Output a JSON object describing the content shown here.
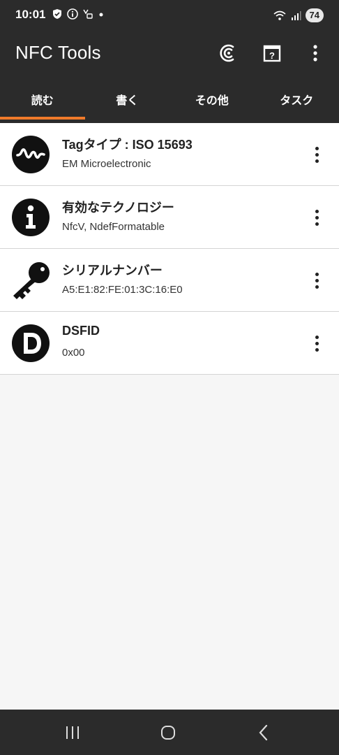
{
  "status": {
    "time": "10:01",
    "battery": "74"
  },
  "app": {
    "title": "NFC Tools",
    "actions": [
      "nfc-scan-icon",
      "help-icon",
      "more-icon"
    ]
  },
  "tabs": [
    {
      "label": "読む",
      "active": true
    },
    {
      "label": "書く",
      "active": false
    },
    {
      "label": "その他",
      "active": false
    },
    {
      "label": "タスク",
      "active": false
    }
  ],
  "items": [
    {
      "title": "Tagタイプ : ISO 15693",
      "subtitle": "EM Microelectronic",
      "icon": "waveform-icon"
    },
    {
      "title": "有効なテクノロジー",
      "subtitle": "NfcV, NdefFormatable",
      "icon": "info-icon"
    },
    {
      "title": "シリアルナンバー",
      "subtitle": "A5:E1:82:FE:01:3C:16:E0",
      "icon": "key-icon"
    },
    {
      "title": "DSFID",
      "subtitle": "0x00",
      "icon": "dsfid-icon"
    }
  ],
  "colors": {
    "bar": "#2b2b2b",
    "accent": "#f07a2a"
  }
}
